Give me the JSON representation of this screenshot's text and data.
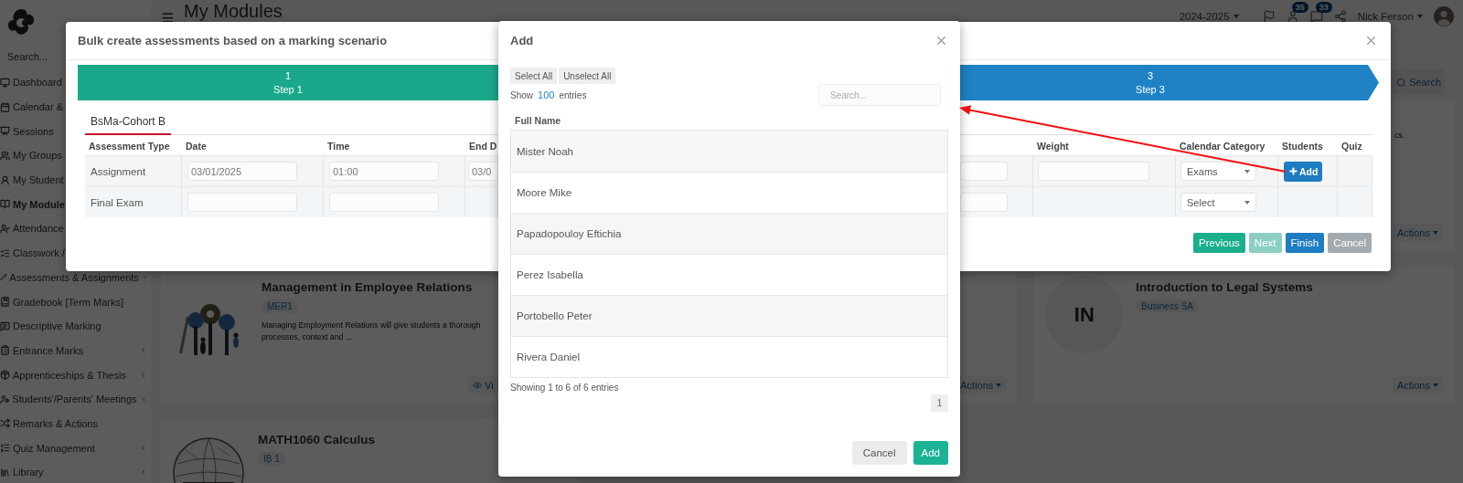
{
  "app_header": {
    "page_title": "My Modules",
    "school_year": "2024-2025",
    "notification_badges": [
      "35",
      "33"
    ],
    "user_name": "Nick Ferson"
  },
  "sidebar": {
    "search_placeholder": "Search...",
    "items": [
      {
        "label": "Dashboard",
        "selected": false
      },
      {
        "label": "Calendar &",
        "selected": false
      },
      {
        "label": "Sessions",
        "selected": false
      },
      {
        "label": "My Groups",
        "selected": false
      },
      {
        "label": "My Student",
        "selected": false
      },
      {
        "label": "My Module",
        "selected": true
      },
      {
        "label": "Attendance",
        "selected": false
      },
      {
        "label": "Classwork /",
        "selected": false
      },
      {
        "label": "Assessments & Assignments",
        "selected": false,
        "expandable": true
      },
      {
        "label": "Gradebook [Term Marks]",
        "selected": false,
        "expandable": false
      },
      {
        "label": "Descriptive Marking",
        "selected": false,
        "expandable": false
      },
      {
        "label": "Entrance Marks",
        "selected": false,
        "expandable": true
      },
      {
        "label": "Apprenticeships & Thesis",
        "selected": false,
        "expandable": true
      },
      {
        "label": "Students'/Parents' Meetings",
        "selected": false,
        "expandable": true
      },
      {
        "label": "Remarks & Actions",
        "selected": false,
        "expandable": false
      },
      {
        "label": "Quiz Management",
        "selected": false,
        "expandable": true
      },
      {
        "label": "Library",
        "selected": false,
        "expandable": true
      }
    ]
  },
  "toolbar": {
    "search_button": "Search"
  },
  "module_cards": [
    {
      "right": {
        "description": [
          "cs."
        ],
        "actions": "Actions"
      }
    },
    {
      "left": {
        "kind": "picture",
        "title": "Management in Employee Relations",
        "tag": "MER1",
        "description": [
          "Managing Employment Relations will give students a thorough",
          "processes, context and ..."
        ],
        "view": "Vi"
      },
      "middle": {
        "actions": "Actions"
      },
      "right": {
        "kind": "avatar",
        "initials": "IN",
        "title": "Introduction to Legal Systems",
        "tag": "Business SA",
        "actions": "Actions"
      }
    },
    {
      "left": {
        "kind": "picture",
        "title": "MATH1060 Calculus",
        "tag": "IB 1"
      }
    }
  ],
  "bulk_dialog": {
    "title": "Bulk create assessments based on a marking scenario",
    "steps": [
      {
        "number": "1",
        "label": "Step 1",
        "selected": false
      },
      {
        "number": "3",
        "label": "Step 3",
        "selected": true
      }
    ],
    "tabs": [
      {
        "label": "BsMa-Cohort B",
        "selected": true
      }
    ],
    "table": {
      "left_columns": [
        "Assessment Type",
        "Date",
        "Time",
        "End D"
      ],
      "right_columns": [
        "Weight",
        "Calendar Category",
        "Students",
        "Quiz"
      ],
      "rows": [
        {
          "left_cells": [
            {
              "kind": "text",
              "value": "Assignment"
            },
            {
              "kind": "input",
              "value": "03/01/2025"
            },
            {
              "kind": "input",
              "value": "01:00"
            },
            {
              "kind": "input",
              "value": "03/0"
            }
          ],
          "right_cells": [
            {
              "kind": "input"
            },
            {
              "kind": "input"
            },
            {
              "kind": "select",
              "value": "Exams"
            },
            {
              "kind": "button",
              "value": "Add"
            },
            {
              "kind": "empty"
            }
          ]
        },
        {
          "left_cells": [
            {
              "kind": "text",
              "value": "Final Exam"
            },
            {
              "kind": "input"
            },
            {
              "kind": "input"
            },
            {
              "kind": "empty"
            }
          ],
          "right_cells": [
            {
              "kind": "input"
            },
            {
              "kind": "empty"
            },
            {
              "kind": "select",
              "value": "Select"
            },
            {
              "kind": "empty"
            },
            {
              "kind": "empty"
            }
          ]
        }
      ]
    },
    "buttons": [
      {
        "label": "Previous",
        "kind": "secondary",
        "disabled": false
      },
      {
        "label": "Next",
        "kind": "secondary",
        "disabled": true
      },
      {
        "label": "Finish",
        "kind": "primary",
        "disabled": false
      },
      {
        "label": "Cancel",
        "kind": "cancel",
        "disabled": true
      }
    ]
  },
  "add_dialog": {
    "title": "Add",
    "bulk_buttons": [
      "Select All",
      "Unselect All"
    ],
    "length_prefix": "Show",
    "length_value": "100",
    "length_suffix": "entries",
    "search_placeholder": "Search...",
    "column": "Full Name",
    "rows": [
      "Mister Noah",
      "Moore Mike",
      "Papadopouloy Eftichia",
      "Perez Isabella",
      "Portobello Peter",
      "Rivera Daniel"
    ],
    "info": "Showing 1 to 6 of 6 entries",
    "pages": [
      {
        "label": "1",
        "selected": true
      }
    ],
    "buttons": [
      {
        "label": "Cancel",
        "kind": "cancel"
      },
      {
        "label": "Add",
        "kind": "primary"
      }
    ]
  },
  "annotations": [
    {
      "kind": "arrow"
    }
  ]
}
